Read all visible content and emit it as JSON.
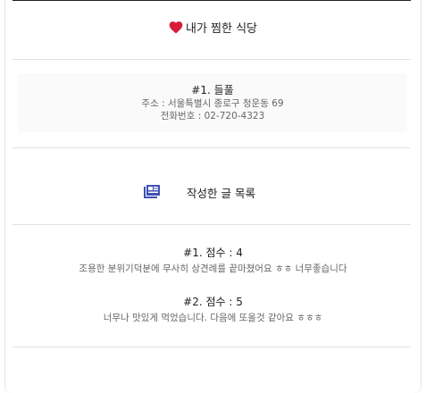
{
  "favorites": {
    "title": "내가 찜한 식당",
    "icon": "heart-icon",
    "icon_color": "#d81b3a"
  },
  "restaurant": {
    "name": "#1. 들풀",
    "address": "주소 : 서울특별시 종로구 청운동 69",
    "phone": "전화번호 : 02-720-4323"
  },
  "posts": {
    "title": "작성한 글 목록",
    "icon": "newspaper-icon",
    "icon_color": "#3f51b5"
  },
  "reviews": [
    {
      "score": "#1. 점수 : 4",
      "text": "조용한 분위기덕분에 무사히 상견례를 끝마쳤어요 ㅎㅎ 너무좋습니다"
    },
    {
      "score": "#2. 점수 : 5",
      "text": "너무나 맛있게 먹었습니다. 다음에 또올것 같아요 ㅎㅎㅎ"
    }
  ]
}
